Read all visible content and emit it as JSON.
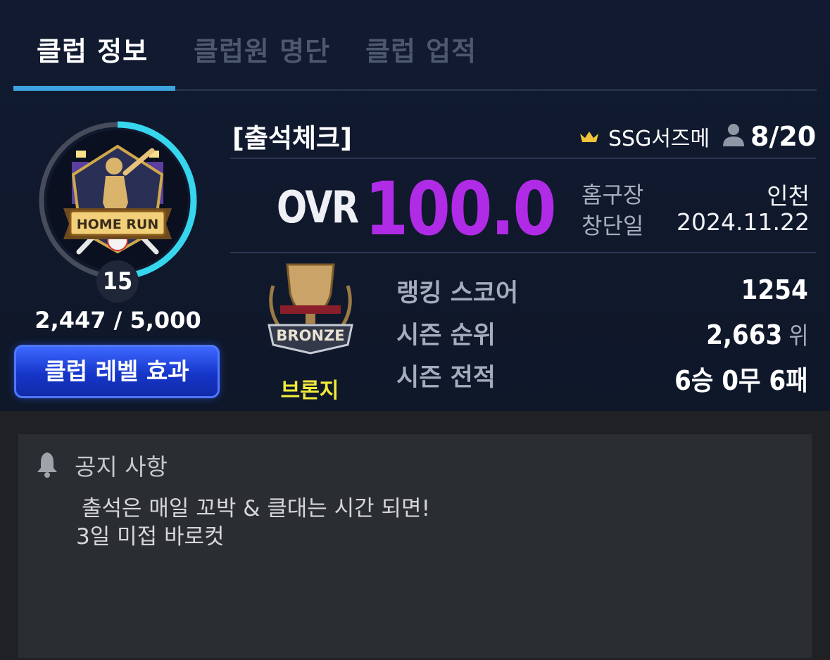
{
  "tabs": [
    {
      "label": "클럽 정보",
      "active": true
    },
    {
      "label": "클럽원 명단",
      "active": false
    },
    {
      "label": "클럽 업적",
      "active": false
    }
  ],
  "club": {
    "name": "[출석체크]",
    "owner": "SSG서즈메",
    "members": "8/20",
    "emblem_text": "HOME RUN",
    "level": "15",
    "xp": "2,447 / 5,000",
    "xp_progress": 0.489,
    "level_effect_button": "클럽 레벨 효과",
    "ovr_label": "OVR",
    "ovr_value": "100.0",
    "home_label": "홈구장",
    "home_value": "인천",
    "founded_label": "창단일",
    "founded_value": "2024.11.22"
  },
  "league": {
    "trophy_text": "BRONZE",
    "tier_name": "브론지",
    "stats": [
      {
        "label": "랭킹 스코어",
        "value": "1254",
        "unit": ""
      },
      {
        "label": "시즌 순위",
        "value": "2,663",
        "unit": "위"
      },
      {
        "label": "시즌 전적",
        "value": "6승 0무 6패",
        "unit": ""
      }
    ]
  },
  "notice": {
    "title": "공지 사항",
    "lines": [
      "출석은 매일 꼬박 & 클대는 시간 되면!",
      "3일 미접 바로컷"
    ]
  },
  "colors": {
    "ovr": "#b02be6",
    "tab_indicator": "#3ea4e0",
    "tier_name": "#f2ea3a",
    "level_button": "#1636c9",
    "progress_ring": "#35d6ee"
  },
  "icons": {
    "crown": "crown-icon",
    "member": "person-icon",
    "bell": "bell-icon"
  }
}
